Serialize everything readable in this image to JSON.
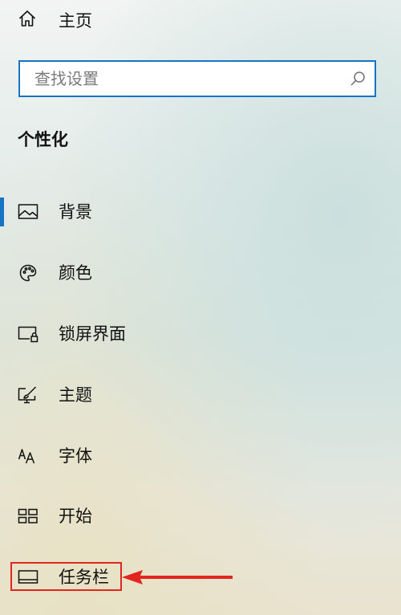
{
  "home": {
    "label": "主页",
    "icon": "home-icon"
  },
  "search": {
    "placeholder": "查找设置",
    "value": "",
    "icon": "search-icon",
    "border_color": "#1773c4"
  },
  "section": {
    "title": "个性化"
  },
  "nav": {
    "selected_index": 0,
    "accent_color": "#1773c4",
    "items": [
      {
        "label": "背景",
        "icon": "picture-icon"
      },
      {
        "label": "颜色",
        "icon": "palette-icon"
      },
      {
        "label": "锁屏界面",
        "icon": "lock-screen-icon"
      },
      {
        "label": "主题",
        "icon": "theme-brush-icon"
      },
      {
        "label": "字体",
        "icon": "font-icon"
      },
      {
        "label": "开始",
        "icon": "start-tiles-icon"
      },
      {
        "label": "任务栏",
        "icon": "taskbar-icon"
      }
    ]
  },
  "annotation": {
    "color": "#e0261e",
    "target": "任务栏"
  }
}
